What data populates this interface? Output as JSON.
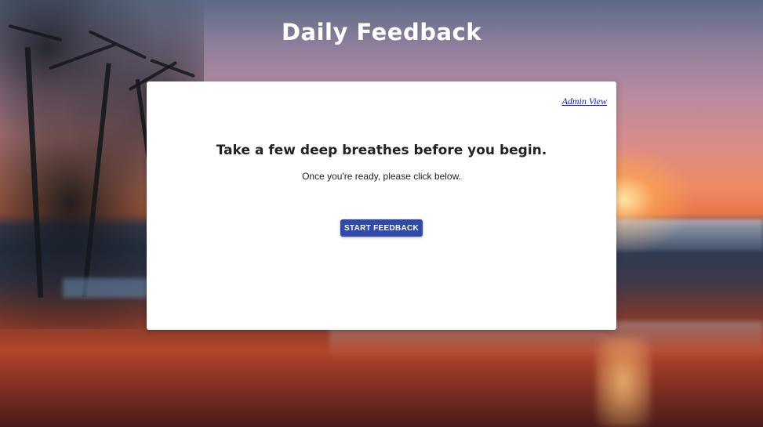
{
  "header": {
    "title": "Daily Feedback"
  },
  "card": {
    "admin_link": "Admin View",
    "heading": "Take a few deep breathes before you begin.",
    "subtext": "Once you're ready, please click below.",
    "start_button": "START FEEDBACK"
  },
  "colors": {
    "button": "#2f4aa8",
    "link": "#0b1fd1",
    "card_background": "#ffffff"
  }
}
